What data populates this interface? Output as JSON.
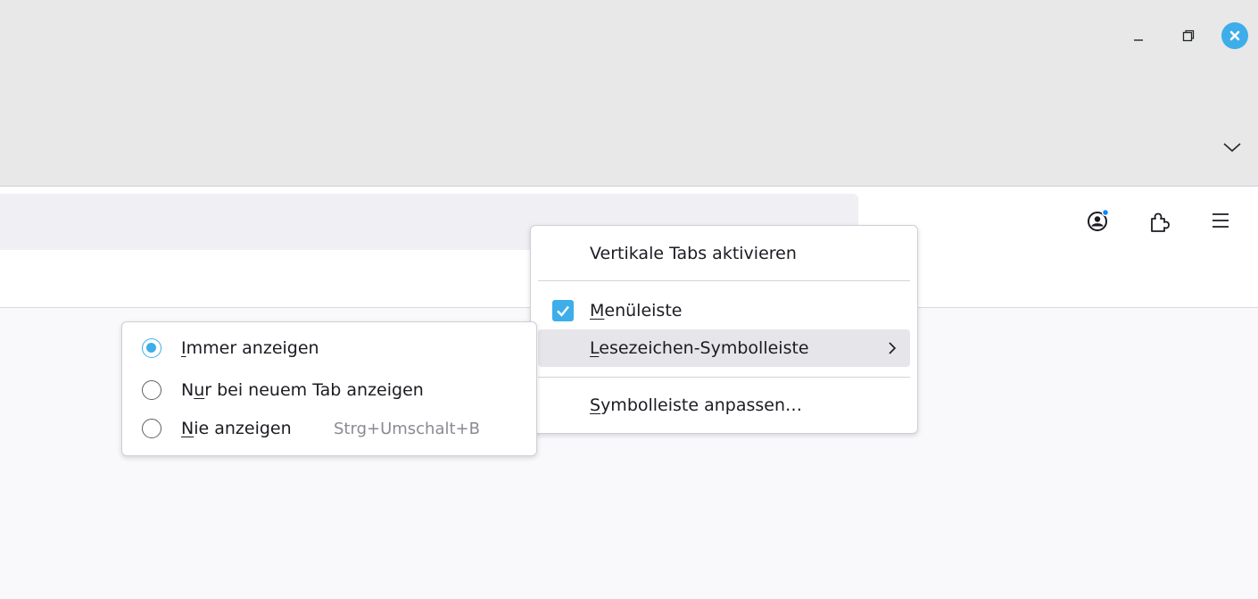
{
  "window": {
    "minimize_icon": "minimize-icon",
    "maximize_icon": "restore-icon",
    "close_icon": "close-icon",
    "tab_list_icon": "chevron-down-icon",
    "accent_color": "#3daee9"
  },
  "toolbar": {
    "account_icon": "account-icon",
    "extensions_icon": "puzzle-icon",
    "menu_icon": "hamburger-icon"
  },
  "context_menu": {
    "vertical_tabs": "Vertikale Tabs aktivieren",
    "menubar": {
      "accesskey": "M",
      "rest": "enüleiste",
      "checked": true
    },
    "bookmarks_toolbar": {
      "accesskey": "L",
      "rest": "esezeichen-Symbolleiste"
    },
    "customize": {
      "accesskey": "S",
      "rest": "ymbolleiste anpassen…"
    }
  },
  "bookmarks_submenu": {
    "always": {
      "accesskey": "I",
      "rest": "mmer anzeigen",
      "selected": true
    },
    "new_tab": {
      "pre": "N",
      "accesskey": "u",
      "rest": "r bei neuem Tab anzeigen",
      "selected": false
    },
    "never": {
      "accesskey": "N",
      "rest": "ie anzeigen",
      "shortcut": "Strg+Umschalt+B",
      "selected": false
    }
  }
}
